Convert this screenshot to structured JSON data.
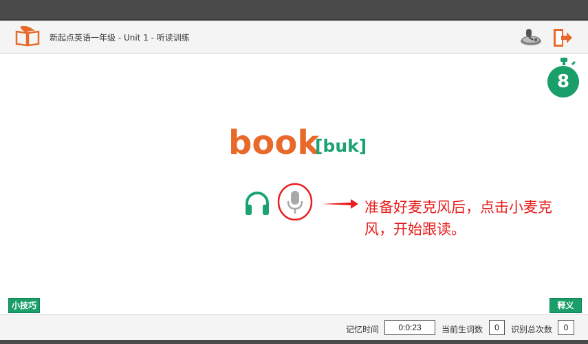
{
  "header": {
    "title": "新起点英语一年级 - Unit 1 - 听读训练",
    "logo_icon": "book-quill-icon",
    "settings_icon": "microphone-settings-icon",
    "exit_icon": "exit-door-icon"
  },
  "timer": {
    "value": "8",
    "icon": "stopwatch-icon"
  },
  "word": {
    "text": "book",
    "phonetic": "[buk]"
  },
  "controls": {
    "headphone_icon": "headphone-icon",
    "mic_icon": "microphone-icon"
  },
  "hint": {
    "text": "准备好麦克风后，点击小麦克风，开始跟读。"
  },
  "buttons": {
    "tips": "小技巧",
    "meaning": "释义"
  },
  "footer": {
    "memory_time_label": "记忆时间",
    "memory_time_value": "0:0:23",
    "new_words_label": "当前生词数",
    "new_words_value": "0",
    "recognitions_label": "识别总次数",
    "recognitions_value": "0"
  },
  "colors": {
    "accent_orange": "#e8692a",
    "accent_green": "#1aa36f",
    "hint_red": "#e81e1e"
  }
}
